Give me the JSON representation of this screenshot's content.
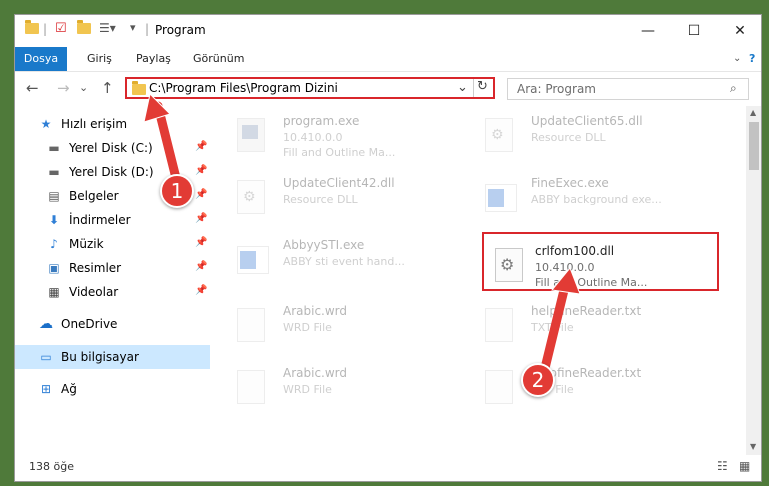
{
  "window": {
    "title": "Program",
    "minimize": "—",
    "maximize": "☐",
    "close": "✕",
    "help": "?"
  },
  "ribbon": {
    "tabs": [
      "Dosya",
      "Giriş",
      "Paylaş",
      "Görünüm"
    ]
  },
  "address": {
    "path": "C:\\Program Files\\Program Dizini",
    "dropdown": "⌄",
    "refresh": "↻"
  },
  "search": {
    "placeholder": "Ara: Program"
  },
  "nav": {
    "back": "←",
    "forward": "→",
    "recent": "⌄",
    "up": "↑"
  },
  "sidebar": {
    "items": [
      {
        "label": "Hızlı erişim"
      },
      {
        "label": "Yerel Disk (C:)"
      },
      {
        "label": "Yerel Disk (D:)"
      },
      {
        "label": "Belgeler"
      },
      {
        "label": "İndirmeler"
      },
      {
        "label": "Müzik"
      },
      {
        "label": "Resimler"
      },
      {
        "label": "Videolar"
      },
      {
        "label": "OneDrive"
      },
      {
        "label": "Bu bilgisayar"
      },
      {
        "label": "Ağ"
      }
    ]
  },
  "files": [
    {
      "name": "program.exe",
      "line1": "10.410.0.0",
      "line2": "Fill and Outline Ma..."
    },
    {
      "name": "UpdateClient65.dll",
      "line1": "Resource DLL",
      "line2": ""
    },
    {
      "name": "UpdateClient42.dll",
      "line1": "Resource DLL",
      "line2": ""
    },
    {
      "name": "FineExec.exe",
      "line1": "ABBY background exe...",
      "line2": ""
    },
    {
      "name": "AbbyySTI.exe",
      "line1": "ABBY sti event hand...",
      "line2": ""
    },
    {
      "name": "crlfom100.dll",
      "line1": "10.410.0.0",
      "line2": "Fill and Outline Ma..."
    },
    {
      "name": "Arabic.wrd",
      "line1": "WRD File",
      "line2": ""
    },
    {
      "name": "helpfineReader.txt",
      "line1": "TXT File",
      "line2": ""
    },
    {
      "name": "Arabic.wrd",
      "line1": "WRD File",
      "line2": ""
    },
    {
      "name": "helpfineReader.txt",
      "line1": "TXT File",
      "line2": ""
    }
  ],
  "status": {
    "count": "138 öğe"
  },
  "annotations": {
    "one": "1",
    "two": "2"
  },
  "colors": {
    "accent": "#1979ca",
    "highlight": "#d9262b",
    "selection": "#cce8ff"
  }
}
